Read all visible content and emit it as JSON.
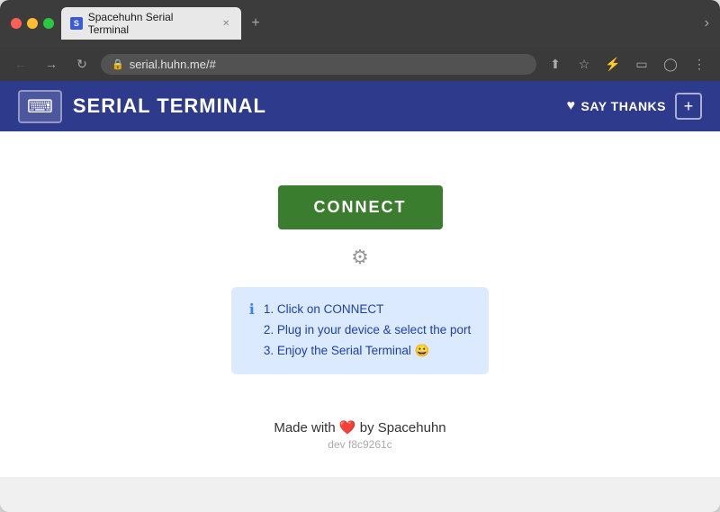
{
  "browser": {
    "tab_title": "Spacehuhn Serial Terminal",
    "favicon_letter": "S",
    "url": "serial.huhn.me/#",
    "new_tab_symbol": "+",
    "chevron_down": "›"
  },
  "navbar": {
    "title": "SERIAL TERMINAL",
    "say_thanks_label": "SAY THANKS",
    "add_label": "+"
  },
  "main": {
    "connect_label": "CONNECT",
    "info_lines": [
      "1. Click on CONNECT",
      "2. Plug in your device & select the port",
      "3. Enjoy the Serial Terminal 😀"
    ]
  },
  "footer": {
    "text": "Made with",
    "by": "by Spacehuhn",
    "version": "dev f8c9261c"
  },
  "icons": {
    "lock": "🔒",
    "heart": "♥",
    "gear": "⚙",
    "info": "ℹ",
    "keyboard": "⌨",
    "back": "←",
    "forward": "→",
    "refresh": "↻",
    "share": "↑",
    "bookmark": "☆",
    "extension": "⚡",
    "reader": "▭",
    "profile": "◯",
    "menu": "⋮"
  },
  "colors": {
    "navbar_bg": "#2e3a8c",
    "connect_btn": "#3a7d2e",
    "info_bg": "#dbeafe",
    "info_text": "#1e40af"
  }
}
